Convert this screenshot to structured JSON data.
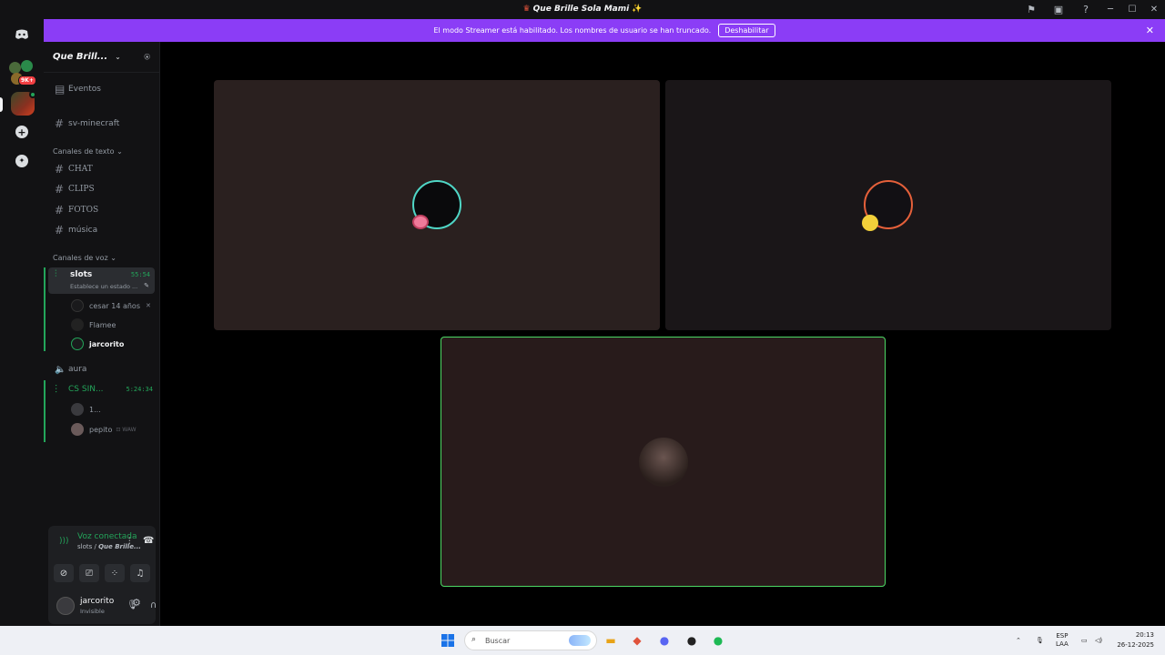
{
  "window": {
    "title": "Que Brille Sola Mami"
  },
  "rail": {
    "badge": "9K+"
  },
  "banner": {
    "text": "El modo Streamer está habilitado. Los nombres de usuario se han truncado.",
    "button": "Deshabilitar"
  },
  "guild": {
    "name": "Que Brill..."
  },
  "channels": {
    "events": "Eventos",
    "top_channel": "sv-minecraft",
    "text_category": "Canales de texto",
    "text": [
      "CHAT",
      "CLIPS",
      "FOTOS",
      "música"
    ],
    "voice_category": "Canales de voz",
    "voice_active": {
      "name": "slots",
      "timer": "55:54",
      "status": "Establece un estado ..."
    },
    "members_slots": [
      "cesar 14 años",
      "Flamee",
      "jarcorito"
    ],
    "aura": "aura",
    "cs": {
      "name": "CS SIN...",
      "timer": "5:24:34"
    },
    "members_cs": [
      "1...",
      "pepito"
    ],
    "pepito_tag": "WAW"
  },
  "voice_panel": {
    "title": "Voz conectada",
    "sub_channel": "slots",
    "sub_server": "Que Brille..."
  },
  "user": {
    "name": "jarcorito",
    "status": "Invisible"
  },
  "taskbar": {
    "search_placeholder": "Buscar",
    "lang1": "ESP",
    "lang2": "LAA",
    "time": "20:13",
    "date": "26-12-2025"
  }
}
